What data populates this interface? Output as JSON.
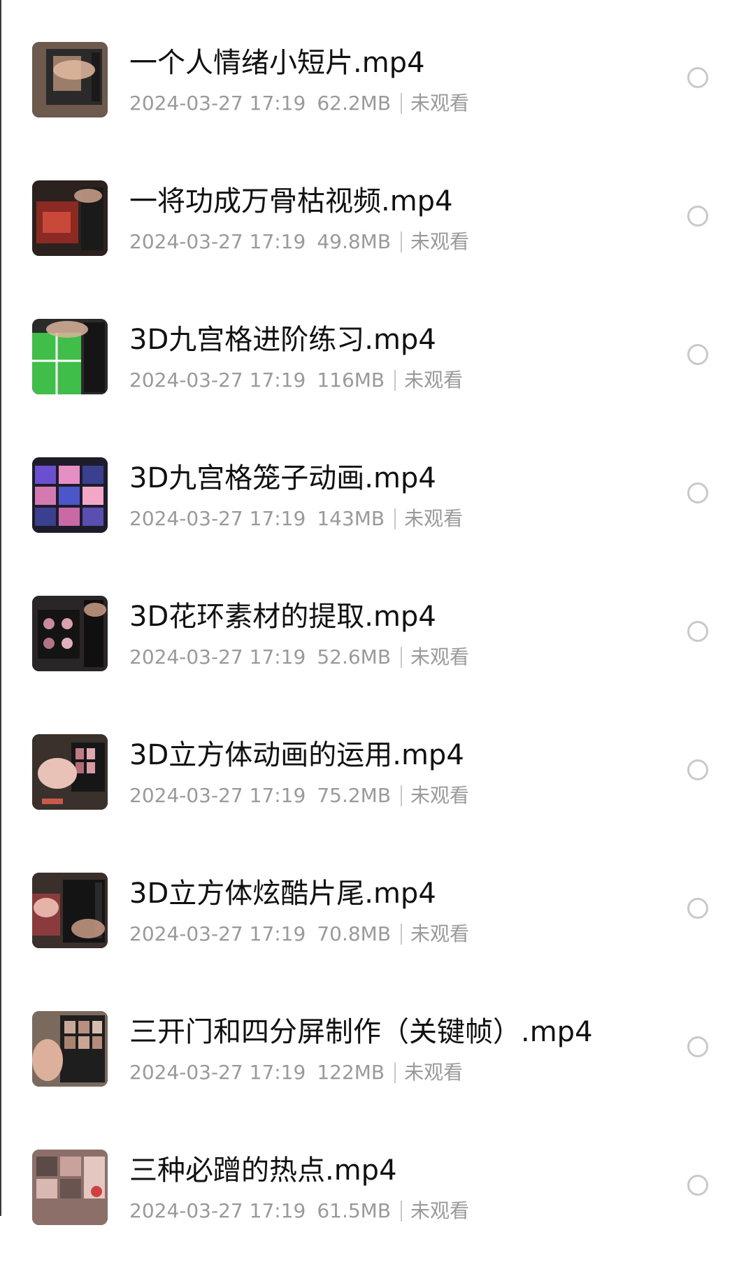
{
  "files": [
    {
      "name": "一个人情绪小短片.mp4",
      "date": "2024-03-27 17:19",
      "size": "62.2MB",
      "status": "未观看",
      "thumb_color": "#6d5a4c"
    },
    {
      "name": "一将功成万骨枯视频.mp4",
      "date": "2024-03-27 17:19",
      "size": "49.8MB",
      "status": "未观看",
      "thumb_color": "#8a2a22"
    },
    {
      "name": "3D九宫格进阶练习.mp4",
      "date": "2024-03-27 17:19",
      "size": "116MB",
      "status": "未观看",
      "thumb_color": "#3fbf4a"
    },
    {
      "name": "3D九宫格笼子动画.mp4",
      "date": "2024-03-27 17:19",
      "size": "143MB",
      "status": "未观看",
      "thumb_color": "#3a3f8f"
    },
    {
      "name": "3D花环素材的提取.mp4",
      "date": "2024-03-27 17:19",
      "size": "52.6MB",
      "status": "未观看",
      "thumb_color": "#2a2527"
    },
    {
      "name": "3D立方体动画的运用.mp4",
      "date": "2024-03-27 17:19",
      "size": "75.2MB",
      "status": "未观看",
      "thumb_color": "#b07a6e"
    },
    {
      "name": "3D立方体炫酷片尾.mp4",
      "date": "2024-03-27 17:19",
      "size": "70.8MB",
      "status": "未观看",
      "thumb_color": "#3b2f2c"
    },
    {
      "name": "三开门和四分屏制作（关键帧）.mp4",
      "date": "2024-03-27 17:19",
      "size": "122MB",
      "status": "未观看",
      "thumb_color": "#7a6a5e"
    },
    {
      "name": "三种必蹭的热点.mp4",
      "date": "2024-03-27 17:19",
      "size": "61.5MB",
      "status": "未观看",
      "thumb_color": "#8c6f68"
    }
  ]
}
